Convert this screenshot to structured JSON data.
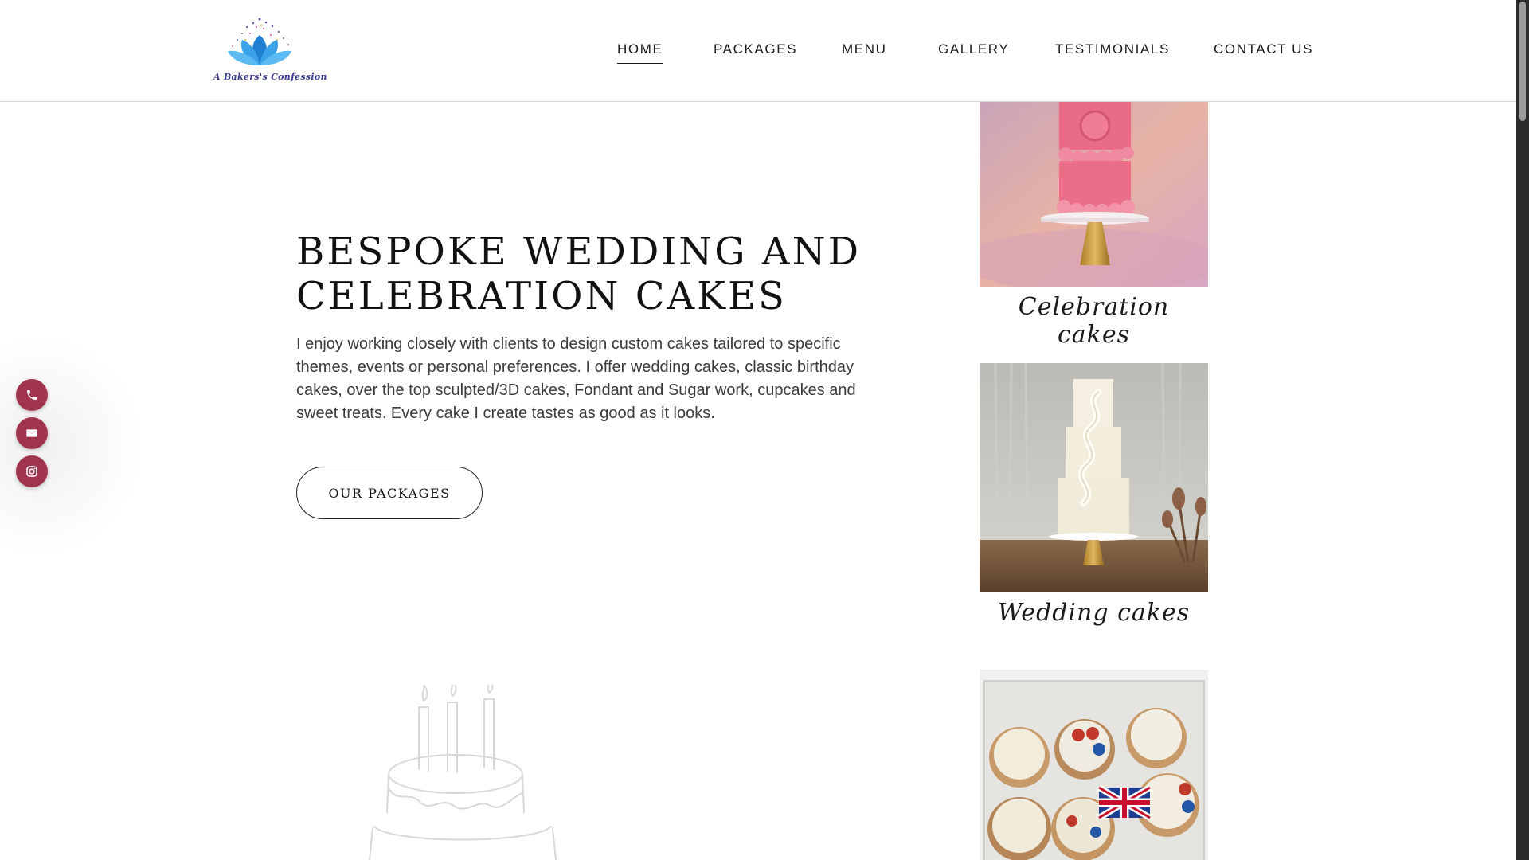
{
  "logo": {
    "text": "A Bakers's Confession"
  },
  "nav": {
    "items": [
      {
        "label": "HOME",
        "active": true
      },
      {
        "label": "PACKAGES",
        "active": false
      },
      {
        "label": "MENU",
        "active": false
      },
      {
        "label": "GALLERY",
        "active": false
      },
      {
        "label": "TESTIMONIALS",
        "active": false
      },
      {
        "label": "CONTACT US",
        "active": false
      }
    ]
  },
  "hero": {
    "title": "BESPOKE WEDDING AND CELEBRATION CAKES",
    "body": "I enjoy working closely with clients to design custom cakes tailored to specific themes, events or personal preferences. I offer wedding cakes, classic birthday cakes, over the top sculpted/3D cakes, Fondant and Sugar work, cupcakes and sweet treats. Every cake I create tastes as good as it looks.",
    "cta_label": "OUR PACKAGES"
  },
  "side_contacts": [
    {
      "icon": "phone-icon"
    },
    {
      "icon": "email-icon"
    },
    {
      "icon": "instagram-icon"
    }
  ],
  "cards": [
    {
      "caption": "Celebration cakes",
      "icon": "pink-cake-photo"
    },
    {
      "caption": "Wedding cakes",
      "icon": "white-wedding-cake-photo"
    },
    {
      "caption": "",
      "icon": "cupcakes-box-photo"
    }
  ],
  "colors": {
    "accent": "#a0344f",
    "text": "#111111",
    "body_text": "#3c3c3c",
    "header_border": "#d9d9d9"
  }
}
